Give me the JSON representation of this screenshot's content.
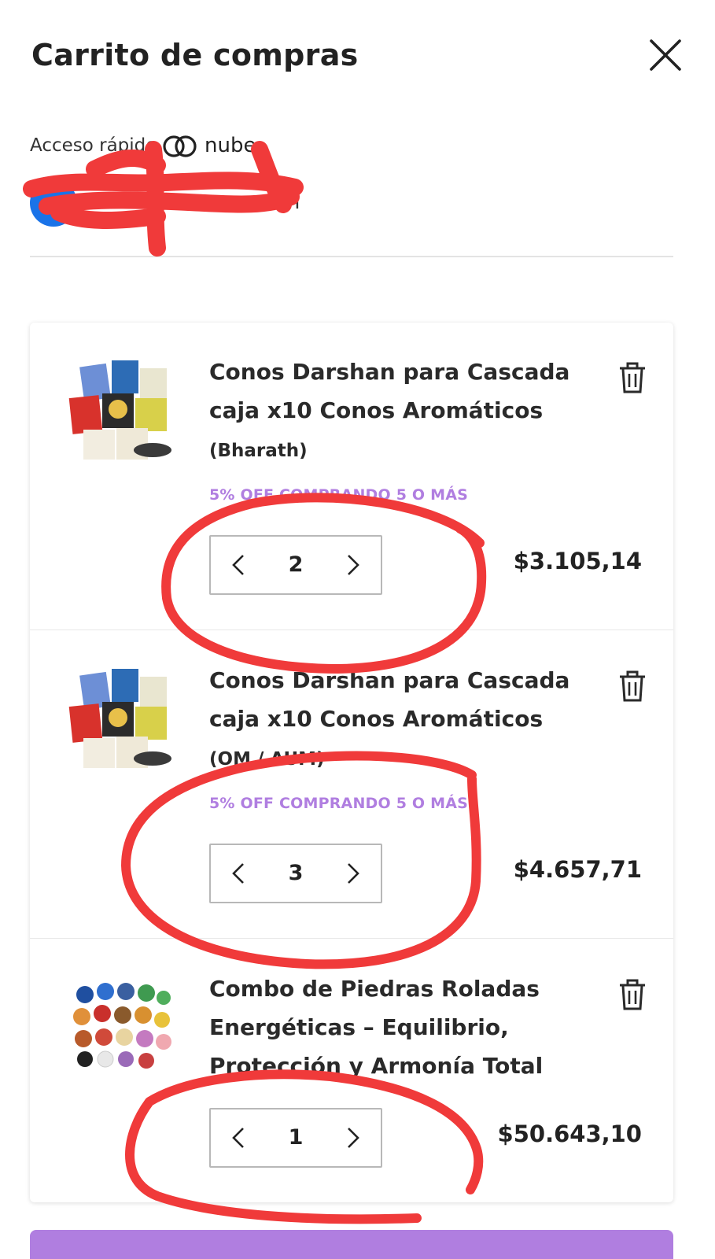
{
  "header": {
    "title": "Carrito de compras"
  },
  "quick_access": {
    "label": "Acceso rápido",
    "brand": "nube",
    "account_email": "m"
  },
  "cart": {
    "items": [
      {
        "name": "Conos Darshan para Cascada caja x10 Conos Aromáticos",
        "variant": "(Bharath)",
        "promo": "5% OFF COMPRANDO 5 O MÁS",
        "quantity": "2",
        "price": "$3.105,14"
      },
      {
        "name": "Conos Darshan para Cascada caja x10 Conos Aromáticos",
        "variant": "(OM / AUM)",
        "promo": "5% OFF COMPRANDO 5 O MÁS",
        "quantity": "3",
        "price": "$4.657,71"
      },
      {
        "name": "Combo de Piedras Roladas Energéticas – Equilibrio, Protección y Armonía Total",
        "variant": "",
        "promo": "",
        "quantity": "1",
        "price": "$50.643,10"
      }
    ]
  },
  "colors": {
    "promo": "#b07ee0",
    "annotation": "#f03a3a",
    "avatar": "#1a73e8"
  }
}
